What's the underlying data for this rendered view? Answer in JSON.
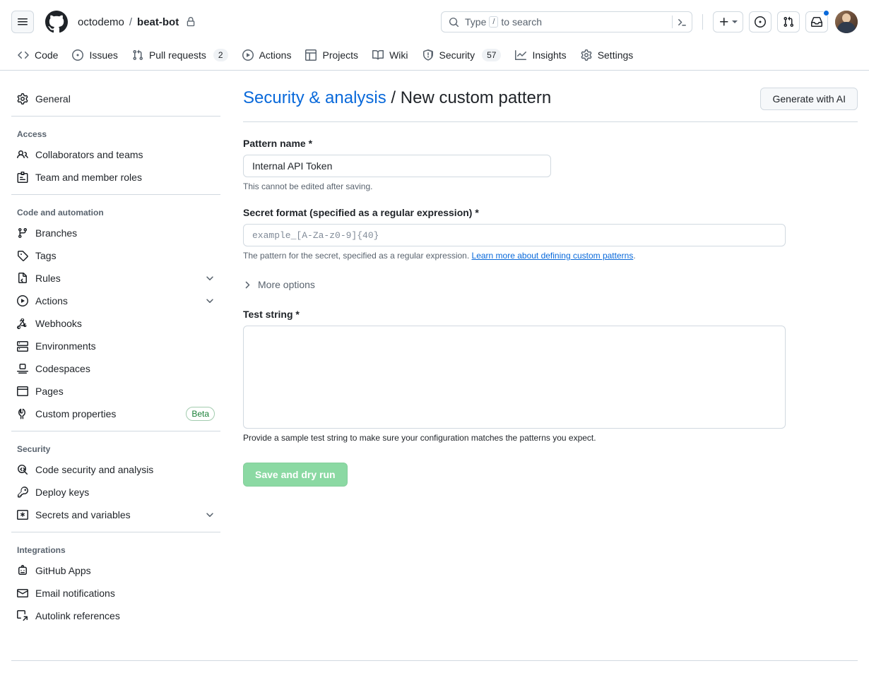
{
  "header": {
    "hamburger_icon": "hamburger-menu-icon",
    "logo_icon": "github-logo-icon",
    "owner": "octodemo",
    "separator": "/",
    "repo": "beat-bot",
    "visibility_icon": "lock-icon",
    "search": {
      "icon": "search-icon",
      "placeholder_before": "Type",
      "placeholder_key": "/",
      "placeholder_after": "to search",
      "terminal_icon": "terminal-icon"
    },
    "create_new_label": "plus-icon",
    "create_new_caret": "triangle-down-icon",
    "issues_icon": "issue-opened-icon",
    "pulls_icon": "git-pull-request-icon",
    "inbox_icon": "inbox-icon",
    "has_notification": true,
    "avatar": "user-avatar"
  },
  "repo_nav": [
    {
      "label": "Code",
      "icon": "code-icon",
      "count": null
    },
    {
      "label": "Issues",
      "icon": "issue-opened-icon",
      "count": null
    },
    {
      "label": "Pull requests",
      "icon": "git-pull-request-icon",
      "count": "2"
    },
    {
      "label": "Actions",
      "icon": "play-icon",
      "count": null
    },
    {
      "label": "Projects",
      "icon": "table-icon",
      "count": null
    },
    {
      "label": "Wiki",
      "icon": "book-icon",
      "count": null
    },
    {
      "label": "Security",
      "icon": "shield-icon",
      "count": "57"
    },
    {
      "label": "Insights",
      "icon": "graph-icon",
      "count": null
    },
    {
      "label": "Settings",
      "icon": "gear-icon",
      "count": null
    }
  ],
  "sidebar": {
    "groups": [
      {
        "heading": null,
        "items": [
          {
            "label": "General",
            "icon": "gear-icon",
            "chevron": false,
            "badge": null
          }
        ]
      },
      {
        "heading": "Access",
        "items": [
          {
            "label": "Collaborators and teams",
            "icon": "people-icon",
            "chevron": false,
            "badge": null
          },
          {
            "label": "Team and member roles",
            "icon": "id-badge-icon",
            "chevron": false,
            "badge": null
          }
        ]
      },
      {
        "heading": "Code and automation",
        "items": [
          {
            "label": "Branches",
            "icon": "git-branch-icon",
            "chevron": false,
            "badge": null
          },
          {
            "label": "Tags",
            "icon": "tag-icon",
            "chevron": false,
            "badge": null
          },
          {
            "label": "Rules",
            "icon": "rules-icon",
            "chevron": true,
            "badge": null
          },
          {
            "label": "Actions",
            "icon": "play-icon",
            "chevron": true,
            "badge": null
          },
          {
            "label": "Webhooks",
            "icon": "webhook-icon",
            "chevron": false,
            "badge": null
          },
          {
            "label": "Environments",
            "icon": "server-icon",
            "chevron": false,
            "badge": null
          },
          {
            "label": "Codespaces",
            "icon": "codespaces-icon",
            "chevron": false,
            "badge": null
          },
          {
            "label": "Pages",
            "icon": "browser-icon",
            "chevron": false,
            "badge": null
          },
          {
            "label": "Custom properties",
            "icon": "tools-icon",
            "chevron": false,
            "badge": "Beta"
          }
        ]
      },
      {
        "heading": "Security",
        "items": [
          {
            "label": "Code security and analysis",
            "icon": "code-scan-icon",
            "chevron": false,
            "badge": null
          },
          {
            "label": "Deploy keys",
            "icon": "key-icon",
            "chevron": false,
            "badge": null
          },
          {
            "label": "Secrets and variables",
            "icon": "asterisk-box-icon",
            "chevron": true,
            "badge": null
          }
        ]
      },
      {
        "heading": "Integrations",
        "items": [
          {
            "label": "GitHub Apps",
            "icon": "app-icon",
            "chevron": false,
            "badge": null
          },
          {
            "label": "Email notifications",
            "icon": "mail-icon",
            "chevron": false,
            "badge": null
          },
          {
            "label": "Autolink references",
            "icon": "cross-reference-icon",
            "chevron": false,
            "badge": null
          }
        ]
      }
    ]
  },
  "main": {
    "title_link": "Security & analysis",
    "title_separator": "/",
    "title_current": "New custom pattern",
    "generate_button": "Generate with AI",
    "pattern_name": {
      "label": "Pattern name",
      "required_mark": "*",
      "value": "Internal API Token",
      "hint": "This cannot be edited after saving."
    },
    "secret_format": {
      "label": "Secret format (specified as a regular expression)",
      "required_mark": "*",
      "value": "",
      "placeholder": "example_[A-Za-z0-9]{40}",
      "hint_text": "The pattern for the secret, specified as a regular expression. ",
      "hint_link": "Learn more about defining custom patterns",
      "hint_suffix": "."
    },
    "more_options": {
      "label": "More options",
      "icon": "chevron-right-icon"
    },
    "test_string": {
      "label": "Test string",
      "required_mark": "*",
      "value": "",
      "hint": "Provide a sample test string to make sure your configuration matches the patterns you expect."
    },
    "submit_button": "Save and dry run"
  },
  "colors": {
    "accent": "#0969da",
    "success": "#1a7f37",
    "button_disabled_green": "#8bd9a3",
    "border": "#d1d9e0",
    "muted_text": "#59636e"
  }
}
